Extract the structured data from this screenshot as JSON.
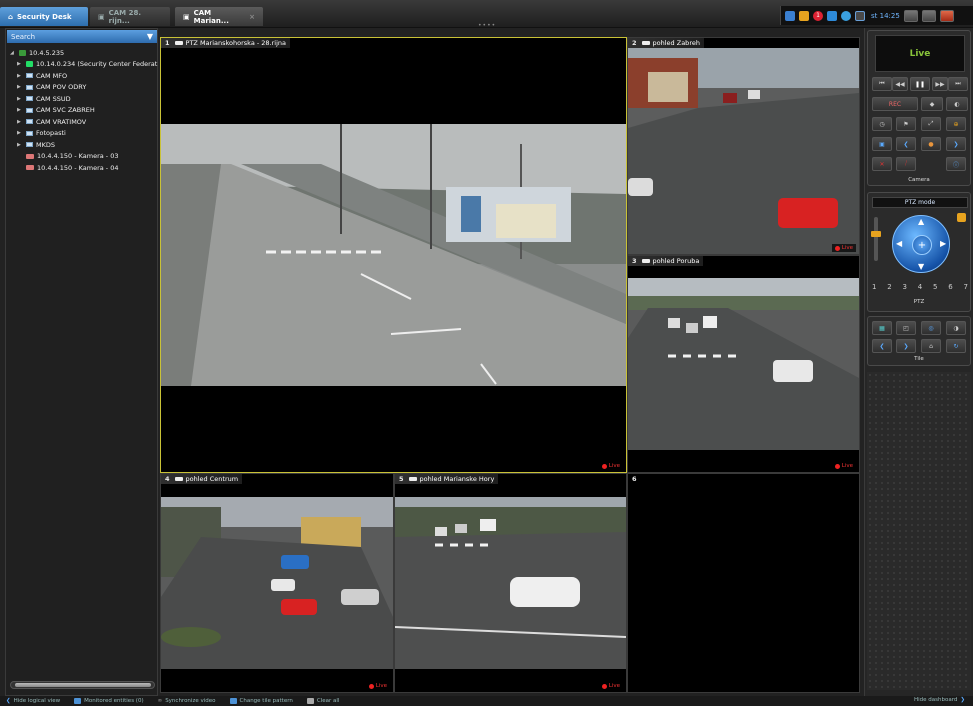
{
  "tabs": {
    "home": "Security Desk",
    "cam1": "CAM 28. rijn...",
    "cam2": "CAM Marian...",
    "close": "×"
  },
  "tray": {
    "clock": "st 14:25",
    "alert_count": "1"
  },
  "sidebar": {
    "search_placeholder": "Search",
    "items": [
      {
        "label": "10.4.5.235",
        "icon": "network-icon",
        "expanded": true
      },
      {
        "label": "10.14.0.234 (Security Center Federat",
        "icon": "federation-icon"
      },
      {
        "label": "CAM MFO",
        "icon": "camera-group-icon"
      },
      {
        "label": "CAM POV ODRY",
        "icon": "camera-group-icon"
      },
      {
        "label": "CAM SSUD",
        "icon": "camera-group-icon"
      },
      {
        "label": "CAM SVC ZABREH",
        "icon": "camera-group-icon"
      },
      {
        "label": "CAM VRATIMOV",
        "icon": "camera-group-icon"
      },
      {
        "label": "Fotopasti",
        "icon": "camera-group-icon"
      },
      {
        "label": "MKDS",
        "icon": "camera-group-icon"
      },
      {
        "label": "10.4.4.150 - Kamera - 03",
        "icon": "camera-icon"
      },
      {
        "label": "10.4.4.150 - Kamera - 04",
        "icon": "camera-icon"
      }
    ]
  },
  "tiles": [
    {
      "num": "1",
      "name": "PTZ Marianskohorska - 28.rijna",
      "live": ""
    },
    {
      "num": "2",
      "name": "pohled Zabreh",
      "live": "Live"
    },
    {
      "num": "3",
      "name": "pohled Poruba",
      "live": "Live"
    },
    {
      "num": "4",
      "name": "pohled Centrum",
      "live": "Live"
    },
    {
      "num": "5",
      "name": "pohled Marianske Hory",
      "live": "Live"
    },
    {
      "num": "6",
      "name": "",
      "live": ""
    }
  ],
  "tile1_live": "Live",
  "camera_panel": {
    "display": "Live",
    "rec_label": "REC",
    "section_label": "Camera"
  },
  "ptz_panel": {
    "mode_label": "PTZ mode",
    "presets": [
      "1",
      "2",
      "3",
      "4",
      "5",
      "6",
      "7"
    ],
    "section_label": "PTZ"
  },
  "tile_panel": {
    "section_label": "Tile"
  },
  "bottombar": {
    "hide_logical": "Hide logical view",
    "monitored": "Monitored entities (0)",
    "sync": "Synchronize video",
    "change_pattern": "Change tile pattern",
    "clear_all": "Clear all",
    "hide_dashboard": "Hide dashboard"
  },
  "colors": {
    "accent": "#2e6cae",
    "live": "#e22222",
    "active_tile": "#c9c236",
    "live_text": "#89c43a"
  }
}
